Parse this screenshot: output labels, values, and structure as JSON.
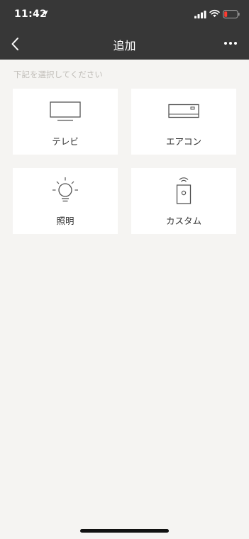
{
  "status_bar": {
    "time": "11:42",
    "battery_color": "#ff3b30"
  },
  "nav": {
    "title": "追加"
  },
  "main": {
    "hint": "下記を選択してください",
    "devices": [
      {
        "label": "テレビ",
        "icon": "tv-icon"
      },
      {
        "label": "エアコン",
        "icon": "air-conditioner-icon"
      },
      {
        "label": "照明",
        "icon": "light-bulb-icon"
      },
      {
        "label": "カスタム",
        "icon": "remote-control-icon"
      }
    ]
  },
  "colors": {
    "header_bg": "#373737",
    "page_bg": "#f5f4f2",
    "card_bg": "#ffffff",
    "hint_text": "#c0bdb8"
  }
}
